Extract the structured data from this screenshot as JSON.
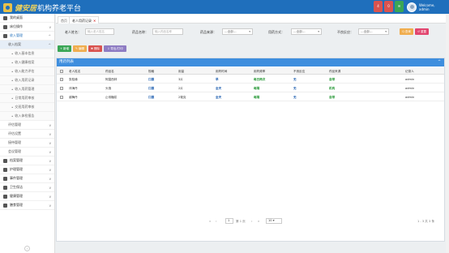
{
  "header": {
    "logo_text_brand": "健安居",
    "logo_text_rest": "机构养老平台",
    "badge1": "4",
    "badge2": "0",
    "user_greeting": "Welcome,",
    "user_name": "admin"
  },
  "sidebar": {
    "items": [
      {
        "label": "我的桌面",
        "level": 0
      },
      {
        "label": "床位操作",
        "level": 0,
        "arrow": "v"
      },
      {
        "label": "收入管理",
        "level": 0,
        "arrow": "^",
        "active": true
      },
      {
        "label": "收入档案",
        "level": 1,
        "arrow": "^",
        "hl": true
      },
      {
        "label": "收入基本信息",
        "level": 2
      },
      {
        "label": "收入健康档案",
        "level": 2
      },
      {
        "label": "收入能力评估",
        "level": 2
      },
      {
        "label": "收入用药记录",
        "level": 2
      },
      {
        "label": "收入用药管理",
        "level": 2
      },
      {
        "label": "日常用药审核",
        "level": 2
      },
      {
        "label": "交班用药审核",
        "level": 2
      },
      {
        "label": "收入体检报告",
        "level": 2
      },
      {
        "label": "评估管理",
        "level": 1,
        "arrow": "v"
      },
      {
        "label": "评估设置",
        "level": 1,
        "arrow": "v"
      },
      {
        "label": "接待管理",
        "level": 1,
        "arrow": "v"
      },
      {
        "label": "会议管理",
        "level": 1,
        "arrow": "v"
      },
      {
        "label": "档案管理",
        "level": 0,
        "arrow": "v"
      },
      {
        "label": "护理管理",
        "level": 0,
        "arrow": "v"
      },
      {
        "label": "事件管理",
        "level": 0,
        "arrow": "v"
      },
      {
        "label": "卫生保洁",
        "level": 0,
        "arrow": "v"
      },
      {
        "label": "健康管理",
        "level": 0,
        "arrow": "v"
      },
      {
        "label": "膳食管理",
        "level": 0,
        "arrow": "v"
      }
    ],
    "collapse": "‹"
  },
  "tabs": [
    {
      "label": "首页"
    },
    {
      "label": "老人用药记录",
      "close": "✕"
    }
  ],
  "filters": {
    "name_label": "老人姓名：",
    "name_placeholder": "输入老人姓名",
    "drug_label": "药品名称：",
    "drug_placeholder": "输入药品名称",
    "source_label": "药品来源：",
    "source_value": "---全部---",
    "method_label": "用药方式：",
    "method_value": "---全部---",
    "reaction_label": "不良反应：",
    "reaction_value": "---全部---",
    "search_btn": "Q 查询",
    "reset_btn": "↺ 重置"
  },
  "actions": {
    "add": "+ 新增",
    "edit": "✎ 编辑",
    "delete": "✖ 删除",
    "export": "⇩ 导出/打印"
  },
  "panel": {
    "title": "用药列表",
    "toggle": "^"
  },
  "table": {
    "columns": [
      "老人姓名",
      "药品名",
      "规格",
      "用量",
      "用药时间",
      "用药频率",
      "不良反应",
      "药品来源",
      "记录人"
    ],
    "rows": [
      [
        "张桂缘",
        "阿莫西林",
        "口服",
        "3片",
        "早",
        "每日两次",
        "无",
        "自带",
        "admin"
      ],
      [
        "邓海丹",
        "头孢",
        "口服",
        "2片",
        "全天",
        "每隔",
        "无",
        "机构",
        "admin"
      ],
      [
        "谢梅丹",
        "止咳糖浆",
        "口服",
        "2毫克",
        "全天",
        "每隔",
        "无",
        "自带",
        "admin"
      ]
    ]
  },
  "pagination": {
    "first": "«",
    "prev": "‹",
    "page": "1",
    "page_text": "第 1 页",
    "next": "›",
    "last": "»",
    "size": "10",
    "size_caret": "▾",
    "summary": "1 - 3 共 3 条"
  },
  "colors": {
    "header": "#1f6fbc",
    "panel_head": "#3e8ede",
    "badge_red": "#d9534f",
    "badge_green": "#3aa655",
    "search": "#f0ad4e",
    "reset": "#e2466f",
    "add": "#3aa655",
    "edit": "#f0ad4e",
    "del": "#d9534f",
    "export": "#8e7cc3"
  }
}
